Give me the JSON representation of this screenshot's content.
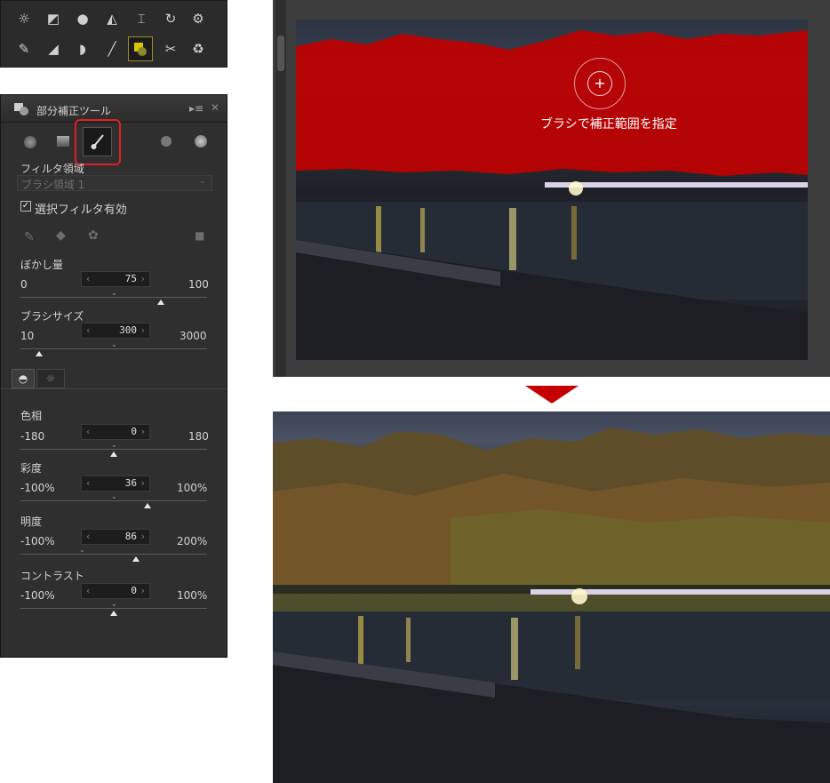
{
  "panel": {
    "title": "部分補正ツール",
    "filter_area_label": "フィルタ領域",
    "filter_area_value": "ブラシ領域 1",
    "enable_filter_label": "選択フィルタ有効",
    "blur": {
      "label": "ぼかし量",
      "min": "0",
      "value": "75",
      "max": "100",
      "level": 0.75
    },
    "brush_size": {
      "label": "ブラシサイズ",
      "min": "10",
      "value": "300",
      "max": "3000",
      "level": 0.1
    },
    "hue": {
      "label": "色相",
      "min": "-180",
      "value": "0",
      "max": "180",
      "level": 0.5
    },
    "saturation": {
      "label": "彩度",
      "min": "-100%",
      "value": "36",
      "max": "100%",
      "level": 0.68
    },
    "brightness": {
      "label": "明度",
      "min": "-100%",
      "value": "86",
      "max": "200%",
      "level": 0.62
    },
    "contrast": {
      "label": "コントラスト",
      "min": "-100%",
      "value": "0",
      "max": "100%",
      "level": 0.5
    }
  },
  "image_top": {
    "caption": "ブラシで補正範囲を指定"
  },
  "colors": {
    "brush_overlay": "#c00000",
    "highlight": "#e02020",
    "arrow": "#c40000"
  },
  "icons": {
    "toolbar": [
      "exposure-icon",
      "levels-icon",
      "color-ball-icon",
      "brush-adjust-icon",
      "straighten-icon",
      "rotate-icon",
      "settings-cog-icon",
      "eyedropper-icon",
      "gradient-icon",
      "fish-icon",
      "brush-icon",
      "local-adjust-icon",
      "retouch-icon",
      "recycle-icon"
    ]
  }
}
